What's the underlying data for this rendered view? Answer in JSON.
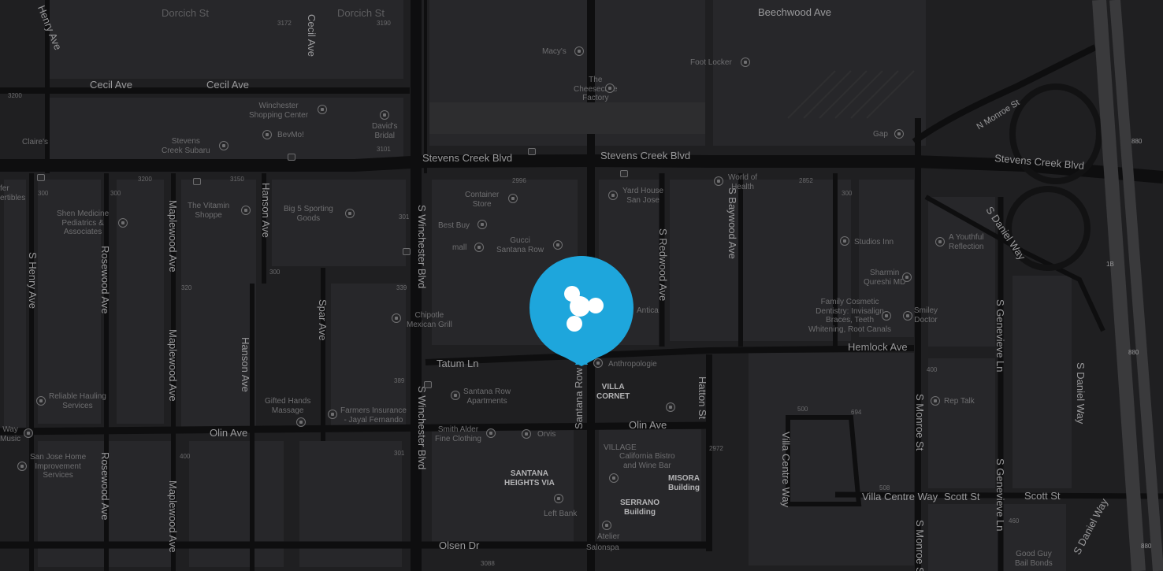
{
  "map": {
    "streets": {
      "dorcich_1": "Dorcich St",
      "dorcich_2": "Dorcich St",
      "beechwood": "Beechwood Ave",
      "cecil_1": "Cecil Ave",
      "cecil_2": "Cecil Ave",
      "cecil_v": "Cecil Ave",
      "henry_top": "Henry Ave",
      "stevens_1": "Stevens Creek Blvd",
      "stevens_2": "Stevens Creek Blvd",
      "stevens_3": "Stevens Creek Blvd",
      "n_monroe": "N Monroe St",
      "s_henry": "S Henry Ave",
      "rosewood_1": "Rosewood Ave",
      "rosewood_2": "Rosewood Ave",
      "maplewood_1": "Maplewood Ave",
      "maplewood_2": "Maplewood Ave",
      "maplewood_3": "Maplewood Ave",
      "hanson_1": "Hanson Ave",
      "hanson_2": "Hanson Ave",
      "spar": "Spar Ave",
      "s_winchester_1": "S Winchester Blvd",
      "s_winchester_2": "S Winchester Blvd",
      "tatum": "Tatum Ln",
      "santana_row": "Santana Row",
      "olin_1": "Olin Ave",
      "olin_2": "Olin Ave",
      "hemlock": "Hemlock Ave",
      "hatton": "Hatton St",
      "s_redwood": "S Redwood Ave",
      "s_baywood": "S Baywood Ave",
      "s_daniel_1": "S Daniel Way",
      "s_daniel_2": "S Daniel Way",
      "s_daniel_3": "S Daniel Way",
      "s_genevieve_1": "S Genevieve Ln",
      "s_genevieve_2": "S Genevieve Ln",
      "s_monroe_1": "S Monroe St",
      "s_monroe_2": "S Monroe St",
      "villa_centre_1": "Villa Centre Way",
      "villa_centre_2": "Villa Centre Way",
      "scott_1": "Scott St",
      "scott_2": "Scott St",
      "olsen": "Olsen Dr"
    },
    "places": {
      "macys": "Macy's",
      "foot_locker": "Foot Locker",
      "cheesecake": "The\nCheesecake\nFactory",
      "winchester_center": "Winchester\nShopping Center",
      "davids_bridal": "David's\nBridal",
      "claires": "Claire's",
      "stevens_subaru": "Stevens\nCreek Subaru",
      "bevmo": "BevMo!",
      "gap": "Gap",
      "container_store": "Container\nStore",
      "best_buy": "Best Buy",
      "gucci": "Gucci\nSantana Row",
      "mall": "mall",
      "yard_house": "Yard House\nSan Jose",
      "world_health": "World of\nHealth",
      "shen_medicine": "Shen Medicine\nPediatrics &\nAssociates",
      "vitamin_shoppe": "The Vitamin\nShoppe",
      "big5": "Big 5 Sporting\nGoods",
      "chipotle": "Chipotle\nMexican Grill",
      "studios_inn": "Studios Inn",
      "a_youthful": "A Youthful\nReflection",
      "sharmin": "Sharmin\nQureshi MD",
      "family_cosmetic": "Family Cosmetic\nDentistry: Invisalign\nBraces, Teeth\nWhitening, Root Canals",
      "smiley": "Smiley\nDoctor",
      "antica": "Antica",
      "anthropologie": "Anthropologie",
      "santana_apts": "Santana Row\nApartments",
      "reliable_hauling": "Reliable Hauling\nServices",
      "gifted_hands": "Gifted Hands\nMassage",
      "farmers": "Farmers Insurance\n- Jayal Fernando",
      "villa_cornet": "VILLA\nCORNET",
      "rep_talk": "Rep Talk",
      "smith_alder": "Smith Alder\nFine Clothing",
      "orvis": "Orvis",
      "way_music": "Way\nMusic",
      "ferfer": "fer\nertibles",
      "san_jose_home": "San Jose Home\nImprovement\nServices",
      "villages": "VILLAGE",
      "california_bistro": "California Bistro\nand Wine Bar",
      "santana_heights": "SANTANA\nHEIGHTS VIA",
      "misora": "MISORA\nBuilding",
      "serrano": "SERRANO\nBuilding",
      "left_bank": "Left Bank",
      "atelier": "Atelier",
      "salonspa": "Salonspa",
      "good_guy": "Good Guy\nBail Bonds"
    },
    "numbers": {
      "n3172": "3172",
      "n3190": "3190",
      "n3200a": "3200",
      "n3101": "3101",
      "n3200b": "3200",
      "n3150": "3150",
      "n2996": "2996",
      "n2852": "2852",
      "n300a": "300",
      "n300b": "300",
      "n300c": "300",
      "n300d": "300",
      "n301a": "301",
      "n320": "320",
      "n339": "339",
      "n389": "389",
      "n301b": "301",
      "n400a": "400",
      "n400b": "400",
      "n500": "500",
      "n694": "694",
      "n508": "508",
      "n2972": "2972",
      "n460": "460",
      "n3088": "3088",
      "n880a": "880",
      "n880b": "880",
      "n880c": "880",
      "n1b": "1B"
    },
    "colors": {
      "background": "#1f1f21",
      "road": "#0f0f10",
      "block": "#2a2a2c",
      "pin": "#1ea6dc"
    },
    "marker_icon": "location-pin-icon"
  }
}
